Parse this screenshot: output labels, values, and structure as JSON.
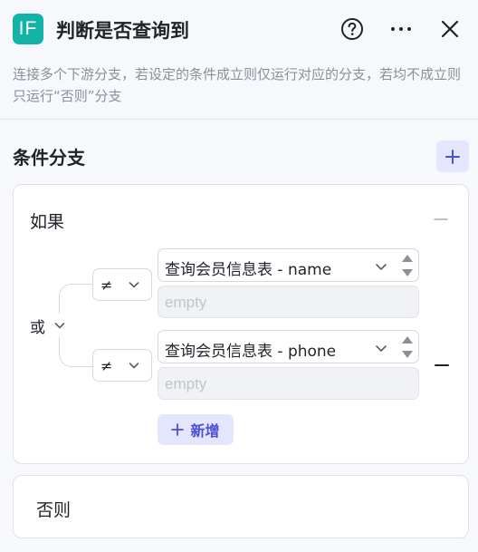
{
  "header": {
    "logo_text": "IF",
    "title": "判断是否查询到",
    "icons": [
      "help-icon",
      "more-icon",
      "close-icon"
    ]
  },
  "description": "连接多个下游分支，若设定的条件成立则仅运行对应的分支，若均不成立则只运行“否则”分支",
  "section": {
    "title": "条件分支",
    "add_icon": "plus-icon"
  },
  "if_branch": {
    "label": "如果",
    "logic": {
      "label": "或",
      "icon": "chevron-down-icon"
    },
    "conditions": [
      {
        "operator": "≠",
        "field": "查询会员信息表 - name",
        "value_placeholder": "empty"
      },
      {
        "operator": "≠",
        "field": "查询会员信息表 - phone",
        "value_placeholder": "empty"
      }
    ],
    "add_label": "新增"
  },
  "else_branch": {
    "label": "否则"
  },
  "colors": {
    "logo": "#14b3a8",
    "accent": "#4a4fd8",
    "accent_bg": "#e4e6fd",
    "background": "#f7f8fc"
  }
}
